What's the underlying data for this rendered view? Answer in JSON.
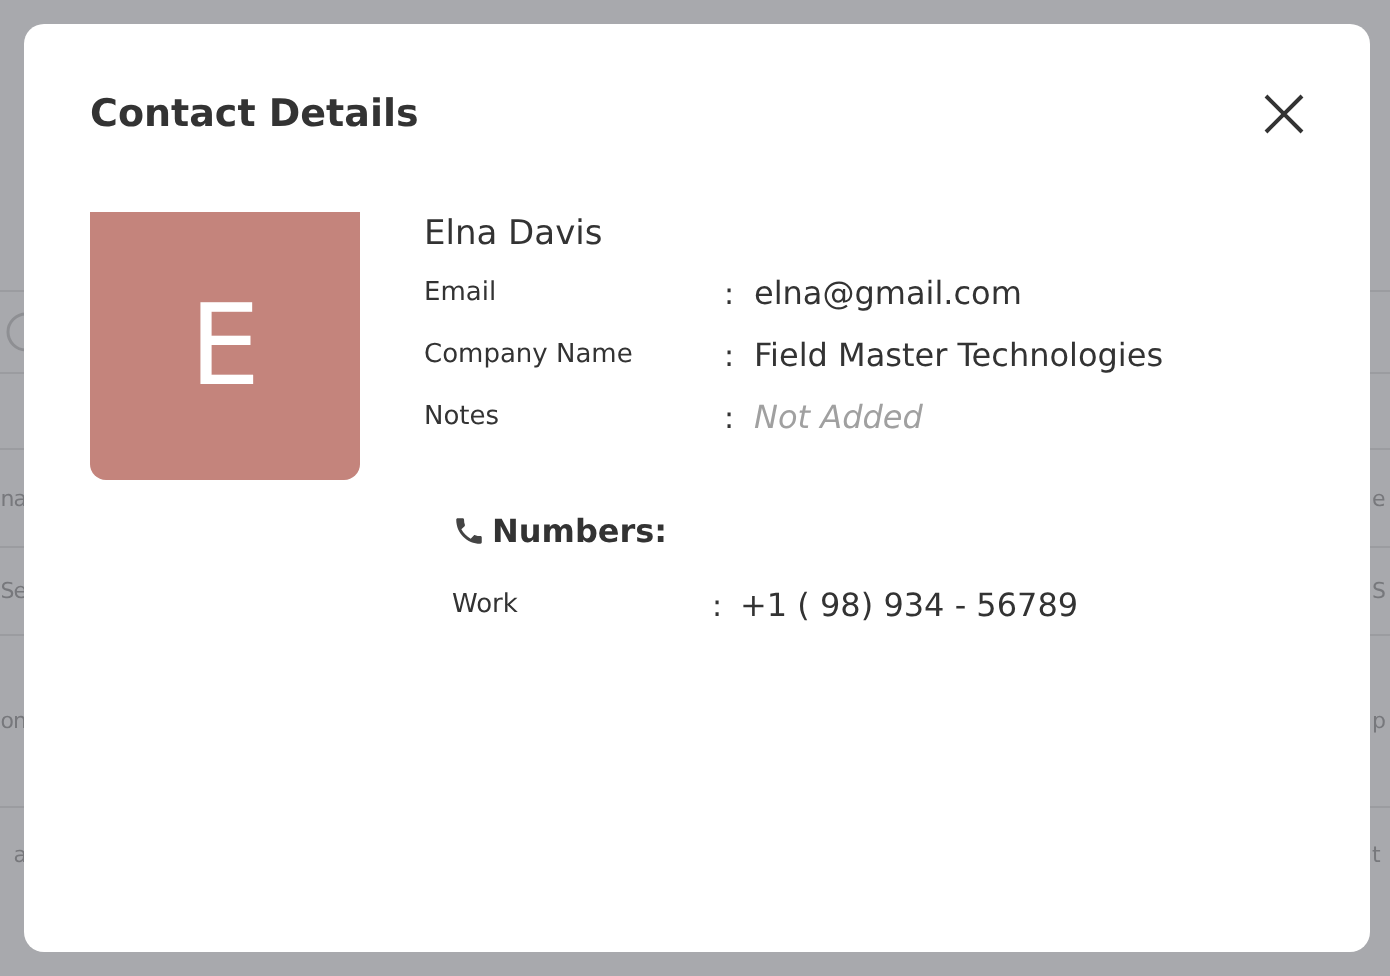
{
  "background": {
    "left_column": [
      "na",
      "Se",
      "on",
      "a"
    ],
    "right_column": [
      "e",
      "S",
      "p",
      "t"
    ]
  },
  "dialog": {
    "title": "Contact Details",
    "contact": {
      "initial": "E",
      "name": "Elna Davis",
      "fields": [
        {
          "label": "Email",
          "separator": ":",
          "value": "elna@gmail.com",
          "kind": "value"
        },
        {
          "label": "Company Name",
          "separator": ":",
          "value": "Field Master Technologies",
          "kind": "value"
        },
        {
          "label": "Notes",
          "separator": ":",
          "value": "Not Added",
          "kind": "empty"
        }
      ]
    },
    "numbers": {
      "heading": "Numbers:",
      "items": [
        {
          "label": "Work",
          "separator": ":",
          "value": "+1 ( 98) 934 - 56789"
        }
      ]
    }
  }
}
